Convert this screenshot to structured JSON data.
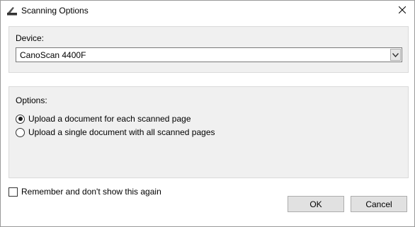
{
  "window": {
    "title": "Scanning Options",
    "app_icon": "scanner-icon",
    "close_icon": "close-icon"
  },
  "device": {
    "label": "Device:",
    "selected": "CanoScan 4400F",
    "dropdown_icon": "chevron-down-icon"
  },
  "options": {
    "label": "Options:",
    "choices": [
      {
        "label": "Upload a document for each scanned page",
        "checked": true
      },
      {
        "label": "Upload a single document with all scanned pages",
        "checked": false
      }
    ]
  },
  "remember": {
    "label": "Remember and don't show this again",
    "checked": false
  },
  "buttons": {
    "ok": "OK",
    "cancel": "Cancel"
  }
}
